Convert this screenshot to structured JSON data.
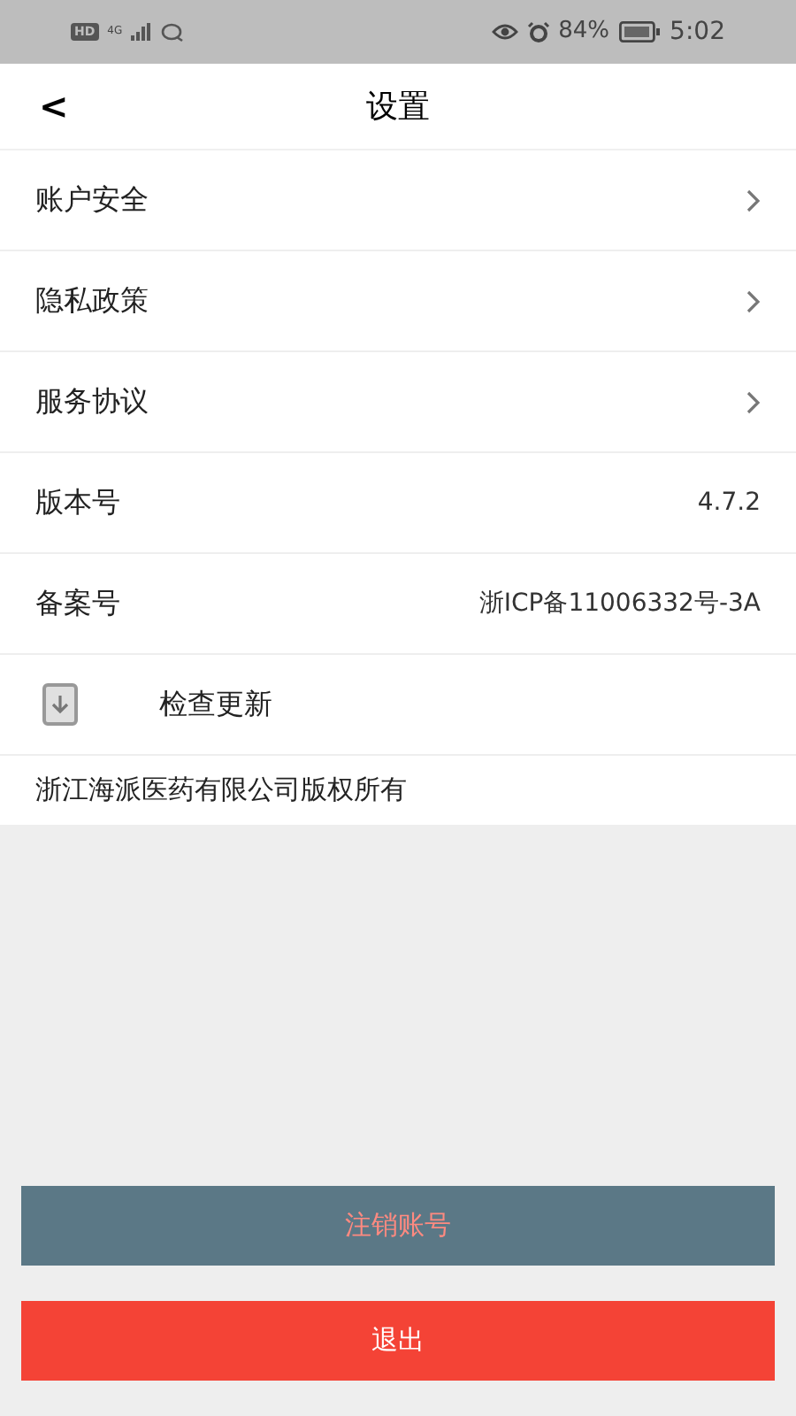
{
  "status_bar": {
    "hd": "HD",
    "network": "4G",
    "battery": "84%",
    "time": "5:02"
  },
  "header": {
    "back": "<",
    "title": "设置"
  },
  "rows": [
    {
      "kind": "link",
      "label": "账户安全"
    },
    {
      "kind": "link",
      "label": "隐私政策"
    },
    {
      "kind": "link",
      "label": "服务协议"
    },
    {
      "kind": "value",
      "label": "版本号",
      "value": "4.7.2"
    },
    {
      "kind": "value",
      "label": "备案号",
      "value": "浙ICP备11006332号-3A"
    },
    {
      "kind": "icon",
      "label": "检查更新"
    }
  ],
  "copyright": "浙江海派医药有限公司版权所有",
  "buttons": [
    {
      "kind": "secondary",
      "label": "注销账号"
    },
    {
      "kind": "danger",
      "label": "退出"
    }
  ]
}
